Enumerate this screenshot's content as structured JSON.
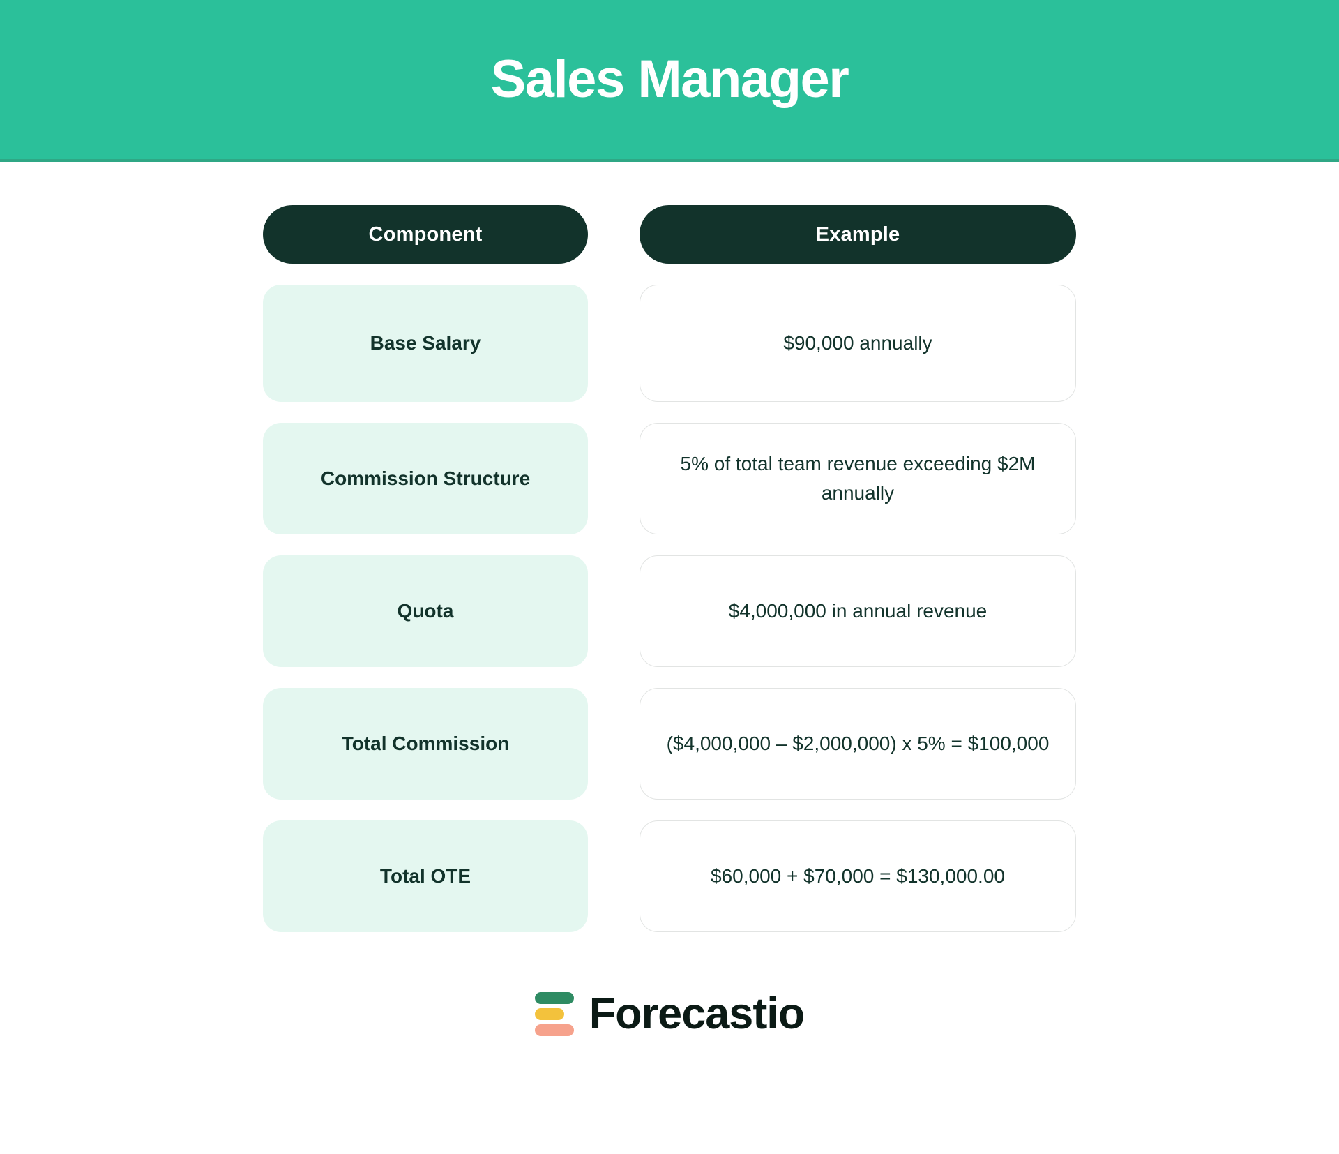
{
  "header": {
    "title": "Sales Manager",
    "background_color": "#2BC09A",
    "border_color": "#2FA785",
    "title_color": "#FFFFFF"
  },
  "table": {
    "columns": [
      {
        "label": "Component"
      },
      {
        "label": "Example"
      }
    ],
    "header_pill_color": "#12332B",
    "left_cell_color": "#E4F7F0",
    "right_cell_border_color": "#E2E4E3",
    "text_color": "#12332B",
    "rows": [
      {
        "component": "Base Salary",
        "example": "$90,000 annually"
      },
      {
        "component": "Commission Structure",
        "example": "5% of total team revenue exceeding $2M annually"
      },
      {
        "component": "Quota",
        "example": "$4,000,000 in annual revenue"
      },
      {
        "component": "Total Commission",
        "example": "($4,000,000 – $2,000,000) x 5% = $100,000"
      },
      {
        "component": "Total OTE",
        "example": "$60,000 + $70,000 = $130,000.00"
      }
    ]
  },
  "footer": {
    "logo_text": "Forecastio",
    "logo_bar_colors": [
      "#2E8B63",
      "#F3C23C",
      "#F6A28C"
    ],
    "logo_text_color": "#0B1A15"
  }
}
